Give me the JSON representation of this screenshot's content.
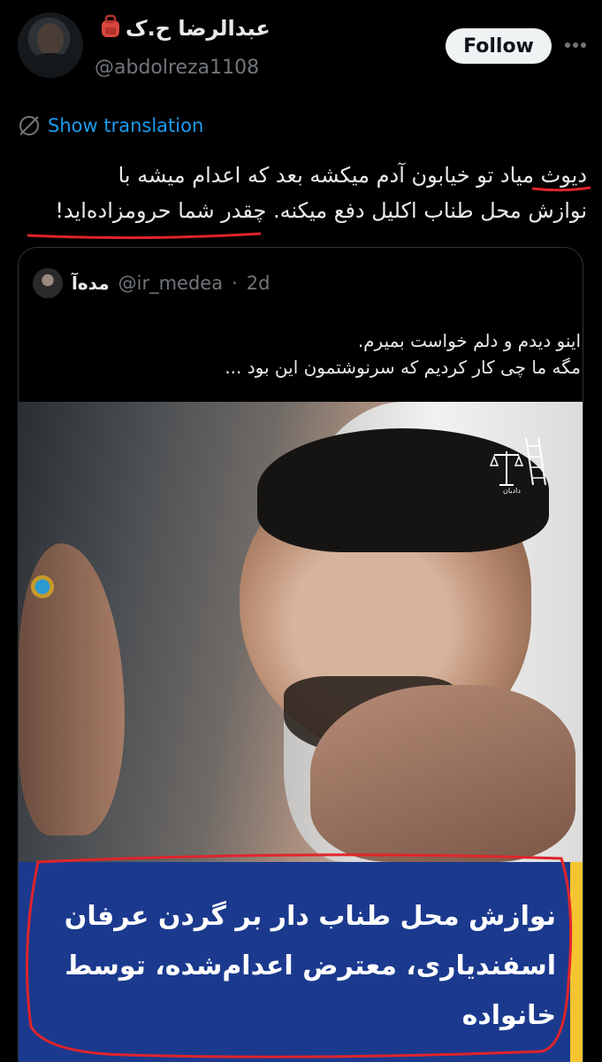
{
  "author": {
    "display_name": "عبدالرضا ح.ک",
    "handle": "@abdolreza1108",
    "follow_label": "Follow"
  },
  "translation": {
    "label": "Show translation"
  },
  "tweet": {
    "line1": "دیوث میاد تو خیابون آدم میکشه بعد که اعدام میشه با",
    "line2": "نوازش محل طناب اکلیل دفع میکنه. چقدر شما حرومزاده‌اید!"
  },
  "quoted": {
    "name": "مده‌آ",
    "handle": "@ir_medea",
    "time": "2d",
    "line1": "اینو دیدم و دلم خواست بمیرم.",
    "line2": "مگه ما چی کار کردیم که سرنوشتمون این بود ...",
    "image_logo_text": "دادبان",
    "caption_line1": "نوازش محل طناب دار بر گردن عرفان",
    "caption_line2": "اسفندیاری، معترض اعدام‌شده، توسط",
    "caption_line3": "خانواده"
  },
  "colors": {
    "background": "#000000",
    "link": "#1d9bf0",
    "annotation_red": "#e0242b",
    "caption_blue": "#1b3a8e",
    "caption_yellow": "#f4c531"
  },
  "icons": {
    "more": "more-horizontal-icon",
    "translate": "translate-globe-icon",
    "emoji": "backpack-emoji-icon",
    "logo": "scales-ladder-logo"
  }
}
